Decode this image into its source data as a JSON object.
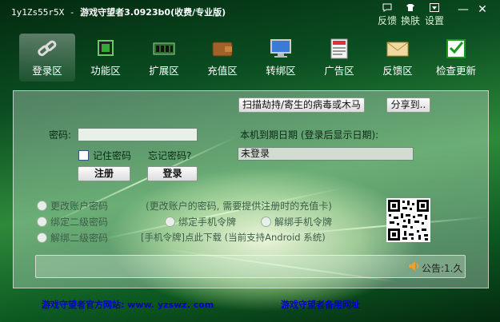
{
  "window": {
    "id": "1y1Zs55r5X",
    "separator": "-",
    "title": "游戏守望者3.0923b0(收费/专业版)"
  },
  "top_controls": [
    {
      "name": "feedback",
      "icon": "chat-bubble-icon",
      "label": "反馈"
    },
    {
      "name": "skin",
      "icon": "shirt-icon",
      "label": "换肤"
    },
    {
      "name": "settings",
      "icon": "dropdown-icon",
      "label": "设置"
    }
  ],
  "window_buttons": {
    "minimize": "—",
    "close": "✕"
  },
  "toolbar": [
    {
      "label": "登录区",
      "icon": "chain-link-icon",
      "active": true
    },
    {
      "label": "功能区",
      "icon": "chip-icon",
      "active": false
    },
    {
      "label": "扩展区",
      "icon": "memory-module-icon",
      "active": false
    },
    {
      "label": "充值区",
      "icon": "wallet-icon",
      "active": false
    },
    {
      "label": "转绑区",
      "icon": "monitor-icon",
      "active": false
    },
    {
      "label": "广告区",
      "icon": "news-icon",
      "active": false
    },
    {
      "label": "反馈区",
      "icon": "envelope-icon",
      "active": false
    },
    {
      "label": "检查更新",
      "icon": "checkbox-update-icon",
      "active": false
    }
  ],
  "login": {
    "scan_button": "扫描劫持/寄生的病毒或木马",
    "share_button": "分享到..",
    "password_label": "密码:",
    "password_value": "",
    "expiry_label": "本机到期日期 (登录后显示日期):",
    "remember_label": "记住密码",
    "forgot_label": "忘记密码?",
    "status_value": "未登录",
    "register_button": "注册",
    "login_button": "登录"
  },
  "options": {
    "change_password": "更改账户密码",
    "change_password_hint": "(更改账户的密码, 需要提供注册时的充值卡)",
    "bind_secondary": "绑定二级密码",
    "bind_phone_token": "绑定手机令牌",
    "unbind_phone_token": "解绑手机令牌",
    "unbind_secondary": "解绑二级密码",
    "token_hint": "[手机令牌]点此下载 (当前支持Android 系统)"
  },
  "notice": {
    "icon": "speaker-icon",
    "text": "公告:1.久"
  },
  "footer": {
    "official_site": "游戏守望者官方网站: www. yzswz. com",
    "backup_site": "游戏守望者备用网址"
  },
  "colors": {
    "accent_green": "#0b4f22",
    "footer_link": "#0000cc"
  }
}
